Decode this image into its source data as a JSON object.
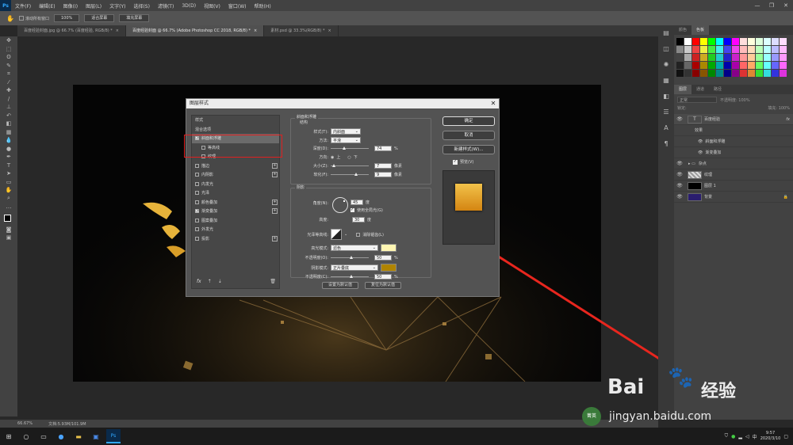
{
  "menubar": {
    "app_icon": "Ps",
    "items": [
      "文件(F)",
      "编辑(E)",
      "图像(I)",
      "图层(L)",
      "文字(Y)",
      "选择(S)",
      "滤镜(T)",
      "3D(D)",
      "视图(V)",
      "窗口(W)",
      "帮助(H)"
    ],
    "win_controls": [
      "—",
      "❐",
      "✕"
    ]
  },
  "options": {
    "scroll_all_label": "滚动所有窗口",
    "zoom_value": "100%",
    "fit_screen": "适合屏幕",
    "fill_screen": "填充屏幕"
  },
  "tabs": [
    {
      "label": "百度经验封面.jpg @ 66.7% (百度经验, RGB/8) *",
      "close": "×"
    },
    {
      "label": "百度经验封面 @ 66.7% (Adobe Photoshop CC 2018, RGB/8) *",
      "close": "×"
    },
    {
      "label": "素材.psd @ 33.3%(RGB/8) *",
      "close": "×"
    }
  ],
  "statusbar": {
    "zoom": "66.67%",
    "doc": "文档:5.93M/101.9M"
  },
  "dialog": {
    "title": "图层样式",
    "close": "✕",
    "styles_header": "样式",
    "blend_options": "混合选项",
    "styles": [
      {
        "label": "斜面和浮雕",
        "checked": true,
        "plus": false,
        "selected": true
      },
      {
        "label": "等高线",
        "checked": false,
        "plus": false,
        "sub": true
      },
      {
        "label": "纹理",
        "checked": false,
        "plus": false,
        "sub": true
      },
      {
        "label": "描边",
        "checked": false,
        "plus": true
      },
      {
        "label": "内阴影",
        "checked": false,
        "plus": true
      },
      {
        "label": "内发光",
        "checked": false,
        "plus": false
      },
      {
        "label": "光泽",
        "checked": false,
        "plus": false
      },
      {
        "label": "颜色叠加",
        "checked": false,
        "plus": true
      },
      {
        "label": "渐变叠加",
        "checked": true,
        "plus": true
      },
      {
        "label": "图案叠加",
        "checked": false,
        "plus": false
      },
      {
        "label": "外发光",
        "checked": false,
        "plus": false
      },
      {
        "label": "投影",
        "checked": false,
        "plus": true
      }
    ],
    "fx_label": "fx",
    "bevel": {
      "title": "斜面和浮雕",
      "structure": "结构",
      "style_label": "样式(T):",
      "style_value": "内斜面",
      "method_label": "方法:",
      "method_value": "平滑",
      "depth_label": "深度(D):",
      "depth_value": "74",
      "depth_unit": "%",
      "depth_level": 0.74,
      "direction_label": "方向:",
      "dir_up": "上",
      "dir_down": "下",
      "size_label": "大小(Z):",
      "size_value": "7",
      "size_unit": "像素",
      "soften_label": "软化(F):",
      "soften_value": "9",
      "soften_unit": "像素",
      "shading": "阴影",
      "angle_label": "角度(N):",
      "angle_value": "45",
      "angle_unit": "度",
      "global_light": "使用全局光(G)",
      "altitude_label": "高度:",
      "altitude_value": "30",
      "altitude_unit": "度",
      "gloss_label": "光泽等高线:",
      "antialias": "消除锯齿(L)",
      "highlight_mode_label": "高光模式:",
      "highlight_mode_value": "滤色",
      "highlight_color": "#fff6b3",
      "highlight_opacity_label": "不透明度(O):",
      "highlight_opacity_value": "50",
      "shadow_mode_label": "阴影模式:",
      "shadow_mode_value": "正片叠底",
      "shadow_color": "#b08400",
      "shadow_opacity_label": "不透明度(C):",
      "shadow_opacity_value": "50",
      "pct": "%",
      "make_default": "设置为默认值",
      "reset_default": "复位为默认值"
    },
    "ok": "确定",
    "cancel": "取消",
    "new_style": "新建样式(W)...",
    "preview": "预览(V)"
  },
  "right": {
    "swatch_tabs": [
      "颜色",
      "色板"
    ],
    "layer_tabs": [
      "图层",
      "通道",
      "路径"
    ],
    "kind_label": "正常",
    "opacity_label": "不透明度: 100%",
    "lock_label": "锁定:",
    "fill_label": "填充: 100%",
    "layers": [
      {
        "name": "百度经验",
        "fx": "fx"
      },
      {
        "name": "效果"
      },
      {
        "name": "斜面和浮雕"
      },
      {
        "name": "渐变叠加"
      },
      {
        "name": "杂点"
      },
      {
        "name": "纹理"
      },
      {
        "name": "图层 1"
      },
      {
        "name": "背景"
      }
    ]
  },
  "taskbar": {
    "time": "9:57",
    "date": "2020/3/10",
    "ime": "中"
  },
  "watermark": {
    "brand": "Bai",
    "brand2": "经验",
    "url": "jingyan.baidu.com",
    "badge": "菁英"
  }
}
